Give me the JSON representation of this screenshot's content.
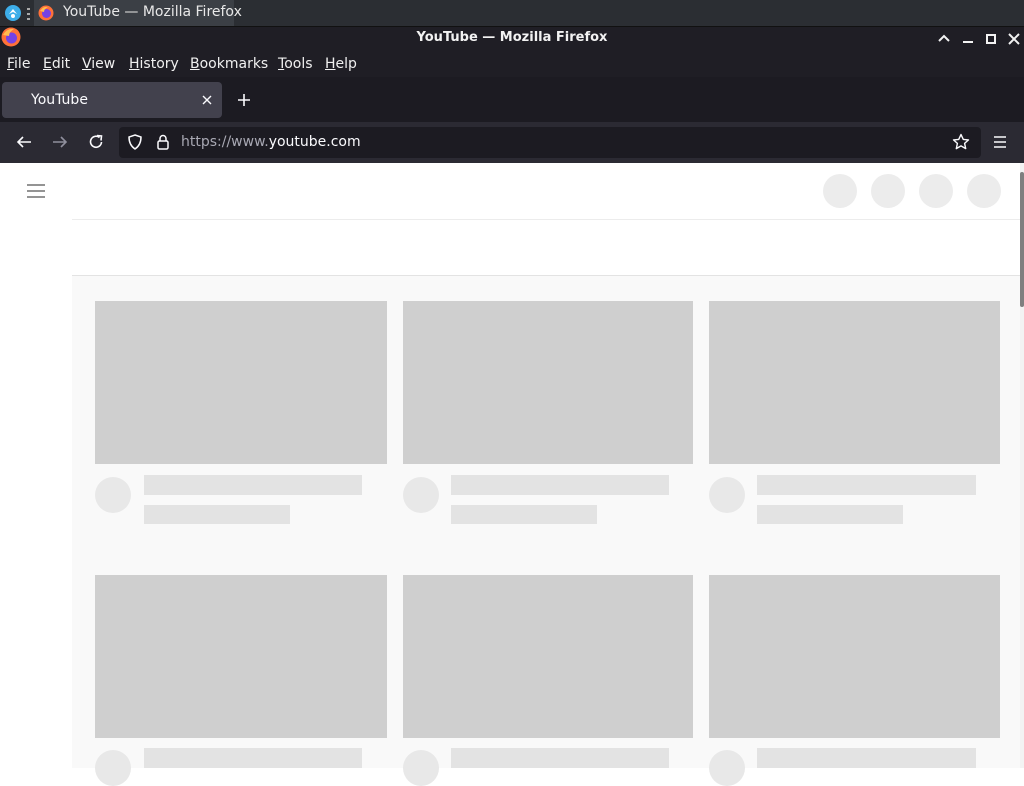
{
  "taskbar": {
    "window_title": "YouTube — Mozilla Firefox"
  },
  "titlebar": {
    "title": "YouTube — Mozilla Firefox"
  },
  "menubar": {
    "items": [
      "File",
      "Edit",
      "View",
      "History",
      "Bookmarks",
      "Tools",
      "Help"
    ]
  },
  "tabs": [
    {
      "label": "YouTube"
    }
  ],
  "urlbar": {
    "url_prefix": "https://www.",
    "url_domain": "youtube.com"
  },
  "colors": {
    "chrome_dark": "#1f1e25",
    "tab_active": "#42414d",
    "skeleton_thumb": "#cfcfcf",
    "skeleton_line": "#e3e3e3",
    "feed_bg": "#f9f9f9"
  },
  "icons": {
    "taskbar": [
      "app-launcher-icon",
      "firefox-icon"
    ],
    "titlebar": [
      "firefox-icon",
      "maximize-icon",
      "minimize-icon",
      "restore-icon",
      "close-icon"
    ],
    "nav": [
      "back-icon",
      "forward-icon",
      "reload-icon",
      "shield-icon",
      "lock-icon",
      "star-icon",
      "app-menu-icon"
    ],
    "page": [
      "hamburger-menu-icon"
    ]
  }
}
